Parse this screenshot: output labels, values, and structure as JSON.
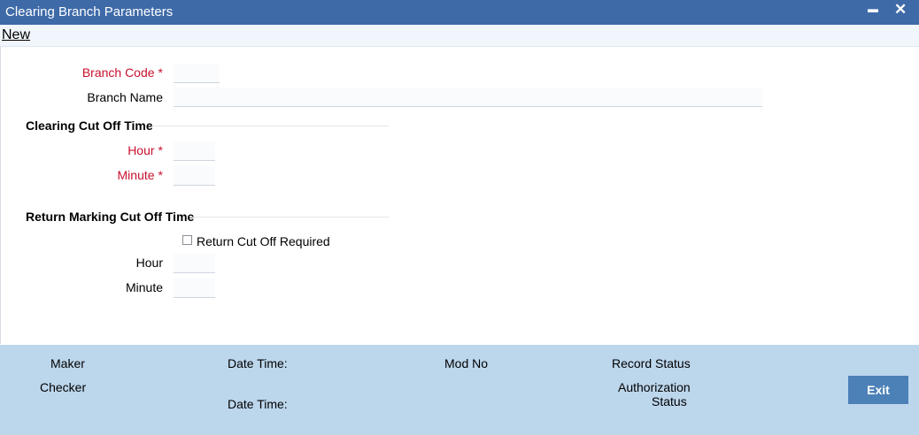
{
  "window": {
    "title": "Clearing Branch Parameters",
    "minimize_glyph": "▬",
    "close_glyph": "✕"
  },
  "menu": {
    "new_label": "New"
  },
  "form": {
    "branch_code": {
      "label": "Branch Code",
      "required_mark": "*",
      "value": ""
    },
    "branch_name": {
      "label": "Branch Name",
      "value": ""
    },
    "clearing_section": {
      "title": "Clearing Cut Off Time",
      "hour": {
        "label": "Hour",
        "required_mark": "*",
        "value": ""
      },
      "minute": {
        "label": "Minute",
        "required_mark": "*",
        "value": ""
      }
    },
    "return_section": {
      "title": "Return Marking Cut Off Time",
      "return_cut_off_required": {
        "label": "Return Cut Off Required",
        "checked": false
      },
      "hour": {
        "label": "Hour",
        "value": ""
      },
      "minute": {
        "label": "Minute",
        "value": ""
      }
    }
  },
  "footer": {
    "maker_label": "Maker",
    "checker_label": "Checker",
    "date_time_label_1": "Date Time:",
    "date_time_label_2": "Date Time:",
    "mod_no_label": "Mod No",
    "record_status_label": "Record Status",
    "authorization_label": "Authorization",
    "status_label": "Status",
    "exit_label": "Exit"
  },
  "colors": {
    "title_bar": "#3e6aa8",
    "required_label": "#c8102e",
    "footer_bg": "#bcd6ec",
    "exit_button": "#4c81b8"
  }
}
